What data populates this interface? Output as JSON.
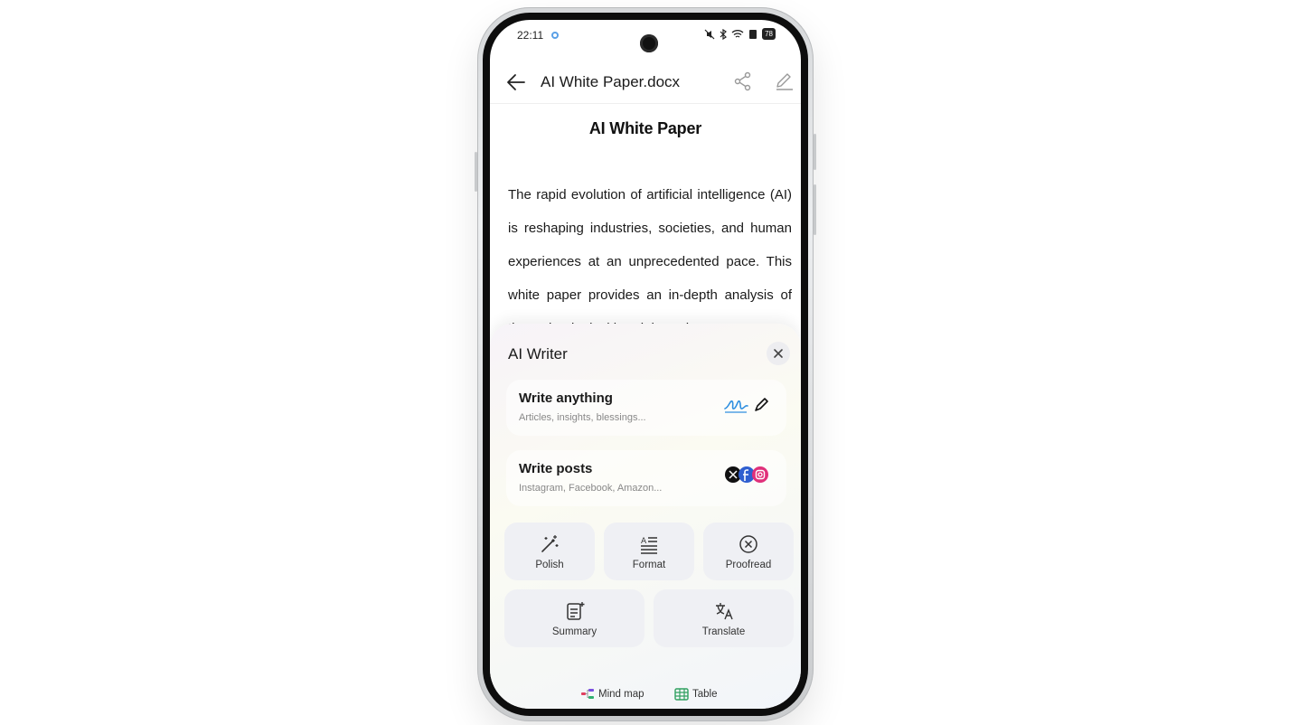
{
  "status": {
    "time": "22:11",
    "battery": "78"
  },
  "appbar": {
    "doc_title": "AI White Paper.docx"
  },
  "document": {
    "heading": "AI White Paper",
    "body": "The rapid evolution of artificial intelligence (AI) is reshaping industries, societies, and human experiences at an unprecedented pace. This white paper provides an in-depth analysis of the technological breakthroughs"
  },
  "ai_writer": {
    "title": "AI Writer",
    "cards": [
      {
        "title": "Write anything",
        "subtitle": "Articles, insights, blessings..."
      },
      {
        "title": "Write posts",
        "subtitle": "Instagram, Facebook, Amazon..."
      }
    ],
    "tools_row1": [
      {
        "label": "Polish",
        "icon": "magic-wand-icon"
      },
      {
        "label": "Format",
        "icon": "format-text-icon"
      },
      {
        "label": "Proofread",
        "icon": "proofread-icon"
      }
    ],
    "tools_row2": [
      {
        "label": "Summary",
        "icon": "summary-icon"
      },
      {
        "label": "Translate",
        "icon": "translate-icon"
      }
    ],
    "chips": [
      {
        "label": "Mind map",
        "icon": "mind-map-icon"
      },
      {
        "label": "Table",
        "icon": "table-icon"
      }
    ]
  },
  "colors": {
    "accent_blue": "#2f8fe0",
    "tool_bg": "#eff0f4"
  }
}
